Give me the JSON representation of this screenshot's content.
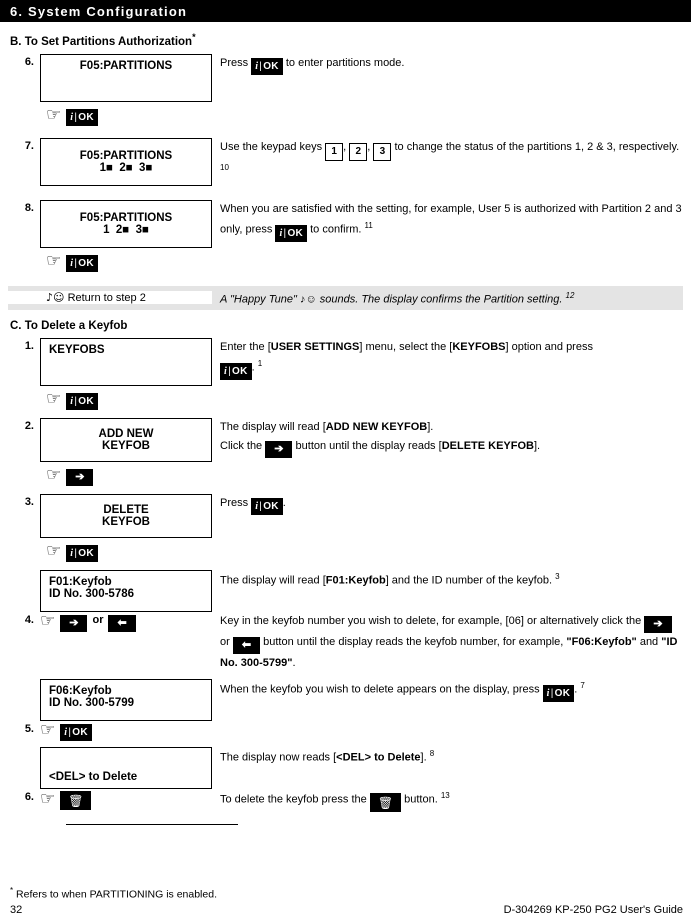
{
  "header": {
    "title": "6. System Configuration"
  },
  "icons": {
    "hand": "☞",
    "note": "♪",
    "smiley": "☺",
    "trash": "🗑",
    "arrow_right": "⇥",
    "arrow_left": "⇤",
    "info": "i",
    "ok": "OK"
  },
  "colors": {
    "header_bg": "#000000",
    "header_text": "#ffffff",
    "key_bg": "#000000",
    "key_text": "#ffffff",
    "tune_band_bg": "#e4e4e4",
    "page_bg": "#ffffff"
  },
  "section_b": {
    "heading": "B. To Set Partitions Authorization",
    "heading_star": "*",
    "steps": [
      {
        "number": "6.",
        "lcd": {
          "lines": [
            "F05:PARTITIONS"
          ],
          "align": "center"
        },
        "text_parts": [
          {
            "t": "text",
            "v": "Press "
          },
          {
            "t": "key_ok"
          },
          {
            "t": "text",
            "v": " to enter partitions mode."
          }
        ],
        "press_key": "key_ok"
      },
      {
        "number": "7.",
        "lcd": {
          "lines": [
            "F05:PARTITIONS",
            "1■  2■  3■"
          ],
          "align": "center"
        },
        "text_parts": [
          {
            "t": "text",
            "v": "Use the keypad keys "
          },
          {
            "t": "key_num",
            "v": "1"
          },
          {
            "t": "text",
            "v": ", "
          },
          {
            "t": "key_num",
            "v": "2"
          },
          {
            "t": "text",
            "v": ", "
          },
          {
            "t": "key_num",
            "v": "3"
          },
          {
            "t": "text",
            "v": " to change the status of the partitions 1, 2 & 3, respectively. "
          },
          {
            "t": "footnote",
            "v": "10"
          }
        ]
      },
      {
        "number": "8.",
        "lcd": {
          "lines": [
            "F05:PARTITIONS",
            "1  2■  3■"
          ],
          "align": "center"
        },
        "text_parts": [
          {
            "t": "text",
            "v": "When you are satisfied with the setting, for example, User 5 is authorized with Partition 2 and 3 only, press "
          },
          {
            "t": "key_ok"
          },
          {
            "t": "text",
            "v": " to confirm. "
          },
          {
            "t": "footnote",
            "v": "11"
          }
        ],
        "press_key": "key_ok"
      }
    ],
    "tune": {
      "left_label": "Return to step 2",
      "right_text": "A \"Happy Tune\" ♪☺ sounds. The display confirms the Partition setting.",
      "right_footnote": "12"
    }
  },
  "section_c": {
    "heading": "C. To Delete a Keyfob",
    "steps": [
      {
        "number": "1.",
        "lcd": {
          "lines": [
            "KEYFOBS"
          ],
          "align": "left"
        },
        "text_parts": [
          {
            "t": "text",
            "v": "Enter the ["
          },
          {
            "t": "bold",
            "v": "USER SETTINGS"
          },
          {
            "t": "text",
            "v": "] menu, select the ["
          },
          {
            "t": "bold",
            "v": "KEYFOBS"
          },
          {
            "t": "text",
            "v": "] option and press "
          },
          {
            "t": "key_ok"
          },
          {
            "t": "text",
            "v": ". "
          },
          {
            "t": "footnote",
            "v": "1"
          }
        ],
        "press_key": "key_ok"
      },
      {
        "number": "2.",
        "lcd": {
          "lines": [
            "ADD NEW",
            "KEYFOB"
          ],
          "align": "center"
        },
        "text_parts": [
          {
            "t": "text",
            "v": "The display will read ["
          },
          {
            "t": "bold",
            "v": "ADD NEW KEYFOB"
          },
          {
            "t": "text",
            "v": "]."
          },
          {
            "t": "br"
          },
          {
            "t": "text",
            "v": "Click the "
          },
          {
            "t": "key_arrow_right"
          },
          {
            "t": "text",
            "v": " button until the display reads ["
          },
          {
            "t": "bold",
            "v": "DELETE KEYFOB"
          },
          {
            "t": "text",
            "v": "]."
          }
        ],
        "press_key": "key_arrow_right"
      },
      {
        "number": "3.",
        "lcd": {
          "lines": [
            "DELETE",
            "KEYFOB"
          ],
          "align": "center"
        },
        "text_parts": [
          {
            "t": "text",
            "v": "Press "
          },
          {
            "t": "key_ok"
          },
          {
            "t": "text",
            "v": "."
          }
        ],
        "press_key": "key_ok"
      }
    ],
    "display_f01": {
      "lines": [
        "F01:Keyfob",
        "ID No. 300-5786"
      ],
      "align": "left"
    },
    "text_f01_parts": [
      {
        "t": "text",
        "v": "The display will read ["
      },
      {
        "t": "bold",
        "v": "F01:Keyfob"
      },
      {
        "t": "text",
        "v": "] and the ID number of the keyfob. "
      },
      {
        "t": "footnote",
        "v": "3"
      }
    ],
    "step4": {
      "number": "4.",
      "text_parts": [
        {
          "t": "text",
          "v": "Key in the keyfob number you wish to delete, for example, [06] or alternatively click the "
        },
        {
          "t": "key_arrow_right"
        },
        {
          "t": "text",
          "v": " or "
        },
        {
          "t": "key_arrow_left"
        },
        {
          "t": "text",
          "v": " button until the display reads the keyfob number, for example, "
        },
        {
          "t": "bold",
          "v": "\"F06:Keyfob\""
        },
        {
          "t": "text",
          "v": " and "
        },
        {
          "t": "bold",
          "v": "\"ID No. 300-5799\""
        },
        {
          "t": "text",
          "v": "."
        }
      ],
      "or_label": "or"
    },
    "display_f06": {
      "lines": [
        "F06:Keyfob",
        "ID No. 300-5799"
      ],
      "align": "left"
    },
    "text_f06_parts": [
      {
        "t": "text",
        "v": "When the keyfob you wish to delete appears on the display, press "
      },
      {
        "t": "key_ok"
      },
      {
        "t": "text",
        "v": ". "
      },
      {
        "t": "footnote",
        "v": "7"
      }
    ],
    "step5": {
      "number": "5."
    },
    "display_del": {
      "lines": [
        "",
        "<DEL> to Delete"
      ],
      "align": "left"
    },
    "text_del_parts": [
      {
        "t": "text",
        "v": "The display now reads ["
      },
      {
        "t": "bold",
        "v": "<DEL> to Delete"
      },
      {
        "t": "text",
        "v": "]. "
      },
      {
        "t": "footnote",
        "v": "8"
      }
    ],
    "step6": {
      "number": "6.",
      "text_parts": [
        {
          "t": "text",
          "v": "To delete the keyfob press the "
        },
        {
          "t": "key_trash"
        },
        {
          "t": "text",
          "v": " button. "
        },
        {
          "t": "footnote",
          "v": "13"
        }
      ]
    }
  },
  "footer": {
    "footnote": "Refers to when PARTITIONING is enabled.",
    "footnote_marker": "*",
    "page_number": "32",
    "doc_ref": "D-304269 KP-250 PG2 User's Guide"
  }
}
